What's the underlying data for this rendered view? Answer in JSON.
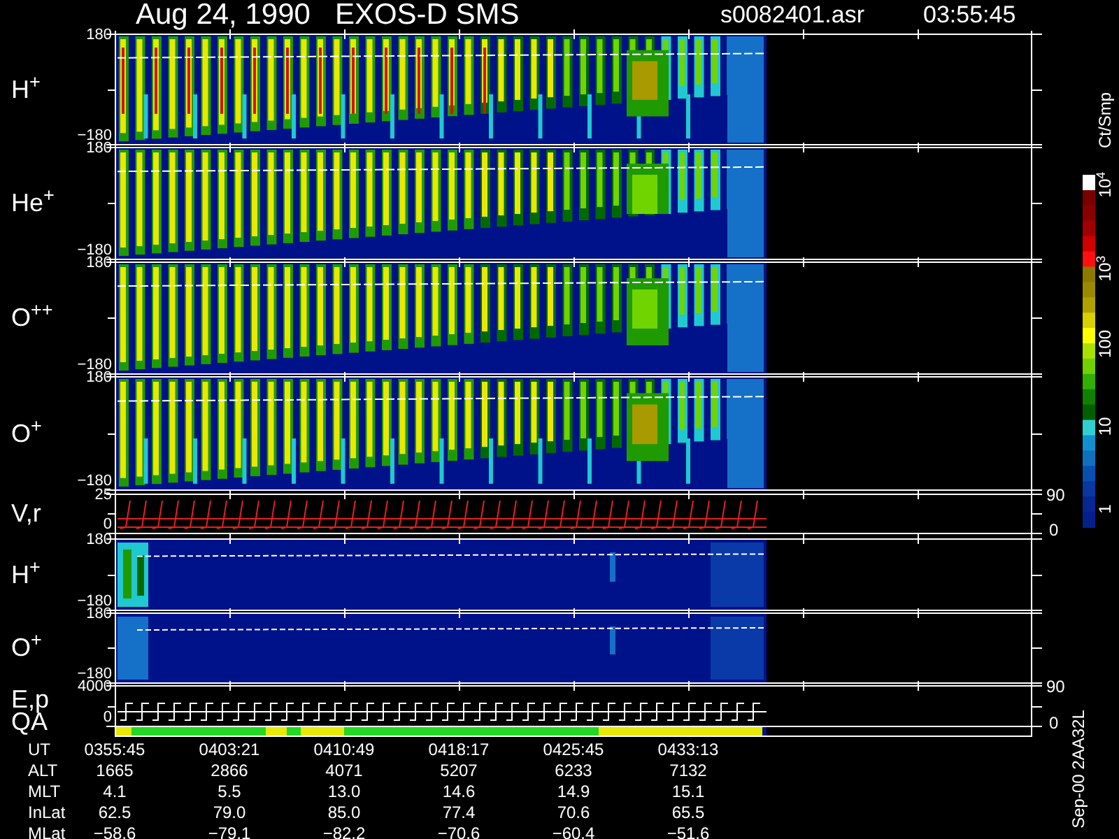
{
  "header": {
    "title": "Aug 24, 1990   EXOS-D SMS",
    "file": "s0082401.asr",
    "time": "03:55:45"
  },
  "panels": [
    {
      "label": "H$^{+}$",
      "kind": "spectrogram",
      "ticks": [
        "180",
        "−180"
      ]
    },
    {
      "label": "He$^{+}$",
      "kind": "spectrogram",
      "ticks": [
        "180",
        "−180"
      ]
    },
    {
      "label": "O$^{++}$",
      "kind": "spectrogram",
      "ticks": [
        "180",
        "−180"
      ]
    },
    {
      "label": "O$^{+}$",
      "kind": "spectrogram",
      "ticks": [
        "180",
        "−180"
      ]
    },
    {
      "label": "V,r",
      "kind": "lines",
      "ticks": [
        "25",
        "0"
      ],
      "right_ticks": [
        "90",
        "0"
      ]
    },
    {
      "label": "H$^{+}$",
      "kind": "sparse",
      "ticks": [
        "180",
        "−180"
      ]
    },
    {
      "label": "O$^{+}$",
      "kind": "sparse",
      "ticks": [
        "180",
        "−180"
      ]
    },
    {
      "label": "E,p",
      "kind": "steps",
      "ticks": [
        "4000",
        "0"
      ],
      "right_ticks": [
        "90",
        "0"
      ]
    }
  ],
  "qa": {
    "label": "QA"
  },
  "colorbar": {
    "unit": "Ct/Smp",
    "labels": [
      "10$^{4}$",
      "10$^{3}$",
      "100",
      "10",
      "1"
    ]
  },
  "table": {
    "rows": [
      {
        "label": "UT",
        "values": [
          "0355:45",
          "0403:21",
          "0410:49",
          "0418:17",
          "0425:45",
          "0433:13"
        ]
      },
      {
        "label": "ALT",
        "values": [
          "1665",
          "2866",
          "4071",
          "5207",
          "6233",
          "7132"
        ]
      },
      {
        "label": "MLT",
        "values": [
          "4.1",
          "5.5",
          "13.0",
          "14.6",
          "14.9",
          "15.1"
        ]
      },
      {
        "label": "InLat",
        "values": [
          "62.5",
          "79.0",
          "85.0",
          "77.4",
          "70.6",
          "65.5"
        ]
      },
      {
        "label": "MLat",
        "values": [
          "−58.6",
          "−79.1",
          "−82.2",
          "−70.6",
          "−60.4",
          "−51.6"
        ]
      }
    ]
  },
  "version": "Sep-00 2AA32L"
}
